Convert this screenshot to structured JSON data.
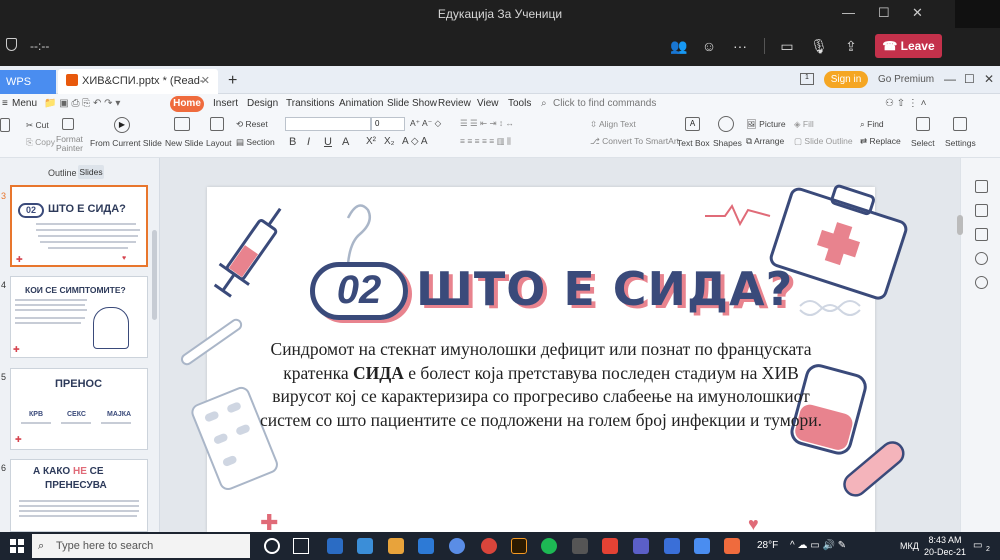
{
  "teams": {
    "window_title": "Едукација За Ученици",
    "timer": "--:--",
    "leave_label": "Leave",
    "window_controls": [
      "—",
      "☐",
      "✕"
    ]
  },
  "wps": {
    "home_tab": "WPS Office",
    "doc_tab": "ХИВ&СПИ.pptx * (Read-Only)",
    "add_tab": "+",
    "sign_in": "Sign in",
    "go_premium": "Go Premium",
    "menu_label": "Menu",
    "menu_tabs": [
      "Home",
      "Insert",
      "Design",
      "Transitions",
      "Animation",
      "Slide Show",
      "Review",
      "View",
      "Tools"
    ],
    "find_placeholder": "Click to find commands",
    "ribbon": {
      "cut": "Cut",
      "copy": "Copy",
      "format_painter": "Format Painter",
      "from_current_slide": "From Current Slide",
      "new_slide": "New Slide",
      "layout": "Layout",
      "reset": "Reset",
      "section": "Section",
      "font_size": "0",
      "align_text": "Align Text",
      "convert_smartart": "Convert To SmartArt",
      "text_box": "Text Box",
      "shapes": "Shapes",
      "picture": "Picture",
      "arrange": "Arrange",
      "fill": "Fill",
      "slide_outline": "Slide Outline",
      "find": "Find",
      "replace": "Replace",
      "select": "Select",
      "settings": "Settings",
      "font_buttons": [
        "B",
        "I",
        "U",
        "A",
        "X²",
        "X₂"
      ]
    },
    "panel_tabs": {
      "outline": "Outline",
      "slides": "Slides"
    }
  },
  "thumbnails": [
    {
      "num": "3",
      "title": "ШТО Е СИДА?"
    },
    {
      "num": "4",
      "title": "КОИ СЕ СИМПТОМИТЕ?"
    },
    {
      "num": "5",
      "title": "ПРЕНОС",
      "items": [
        "КРВ",
        "СЕКС",
        "МАЈКА"
      ]
    },
    {
      "num": "6",
      "title_a": "А КАКО ",
      "title_b": "НЕ",
      "title_c": " СЕ",
      "title_d": "ПРЕНЕСУВА"
    }
  ],
  "slide": {
    "number": "02",
    "title": "ШТО Е СИДА?",
    "body_pre": "Синдромот на стекнат имунолошки дефицит или познат по француската кратенка ",
    "body_bold": "СИДА",
    "body_post": " е болест која претставува последен стадиум на ХИВ вирусот кој се карактеризира со прогресиво слабеење на имунолошкиот систем со што пациентите се подложени на голем број инфекции и тумори."
  },
  "taskbar": {
    "search_placeholder": "Type here to search",
    "weather": "28°F",
    "lang": "МКД",
    "time": "8:43 AM",
    "date": "20-Dec-21",
    "notif_count": "2"
  },
  "colors": {
    "accent_orange": "#ef6b3d",
    "slide_navy": "#3a4a7a",
    "slide_pink": "#e8838e",
    "leave_red": "#c4314b"
  }
}
